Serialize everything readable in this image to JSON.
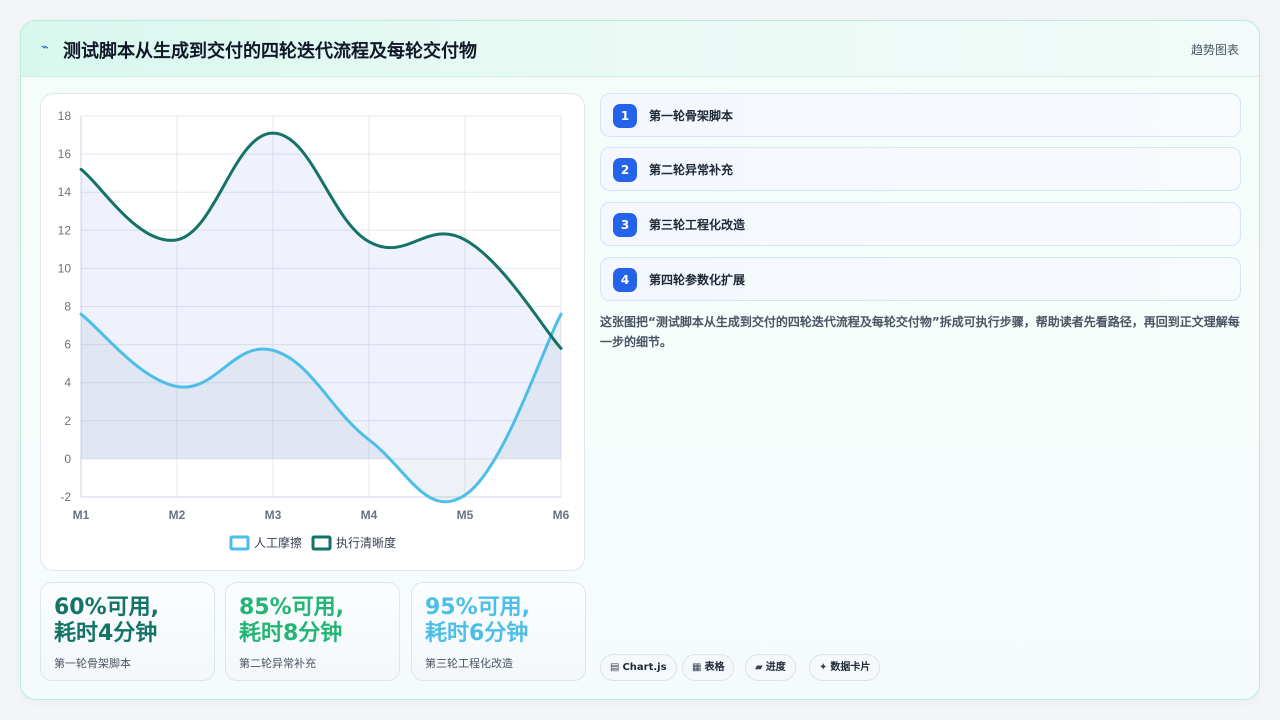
{
  "header": {
    "icon": "spark-icon",
    "title": "测试脚本从生成到交付的四轮迭代流程及每轮交付物",
    "right_label": "趋势图表"
  },
  "chart_data": {
    "type": "line",
    "categories": [
      "M1",
      "M2",
      "M3",
      "M4",
      "M5",
      "M6"
    ],
    "ylim": [
      -2,
      18
    ],
    "yticks": [
      -2,
      0,
      2,
      4,
      6,
      8,
      10,
      12,
      14,
      16,
      18
    ],
    "grid": true,
    "legend_position": "bottom",
    "series": [
      {
        "name": "人工摩擦",
        "values": [
          7.6,
          3.8,
          5.7,
          1.0,
          -1.9,
          7.6
        ],
        "color": "#4cbfe8",
        "fill": "rgba(160,175,200,0.18)"
      },
      {
        "name": "执行清晰度",
        "values": [
          15.2,
          11.5,
          17.1,
          11.4,
          11.5,
          5.8
        ],
        "color": "#137366",
        "fill": "rgba(120,150,240,0.12)"
      }
    ]
  },
  "stats": [
    {
      "value": "60%可用,耗时4分钟",
      "label": "第一轮骨架脚本",
      "color": "#137366"
    },
    {
      "value": "85%可用,耗时8分钟",
      "label": "第二轮异常补充",
      "color": "#22b573"
    },
    {
      "value": "95%可用,耗时6分钟",
      "label": "第三轮工程化改造",
      "color": "#4cbfe8"
    }
  ],
  "steps": [
    {
      "num": "1",
      "label": "第一轮骨架脚本"
    },
    {
      "num": "2",
      "label": "第二轮异常补充"
    },
    {
      "num": "3",
      "label": "第三轮工程化改造"
    },
    {
      "num": "4",
      "label": "第四轮参数化扩展"
    }
  ],
  "description": "这张图把“测试脚本从生成到交付的四轮迭代流程及每轮交付物”拆成可执行步骤，帮助读者先看路径，再回到正文理解每一步的细节。",
  "tags": [
    {
      "icon": "chart-icon",
      "glyph": "▤",
      "label": "Chart.js"
    },
    {
      "icon": "table-icon",
      "glyph": "▦",
      "label": "表格"
    },
    {
      "icon": "progress-icon",
      "glyph": "▰",
      "label": "进度"
    },
    {
      "icon": "card-icon",
      "glyph": "✦",
      "label": "数据卡片"
    }
  ]
}
